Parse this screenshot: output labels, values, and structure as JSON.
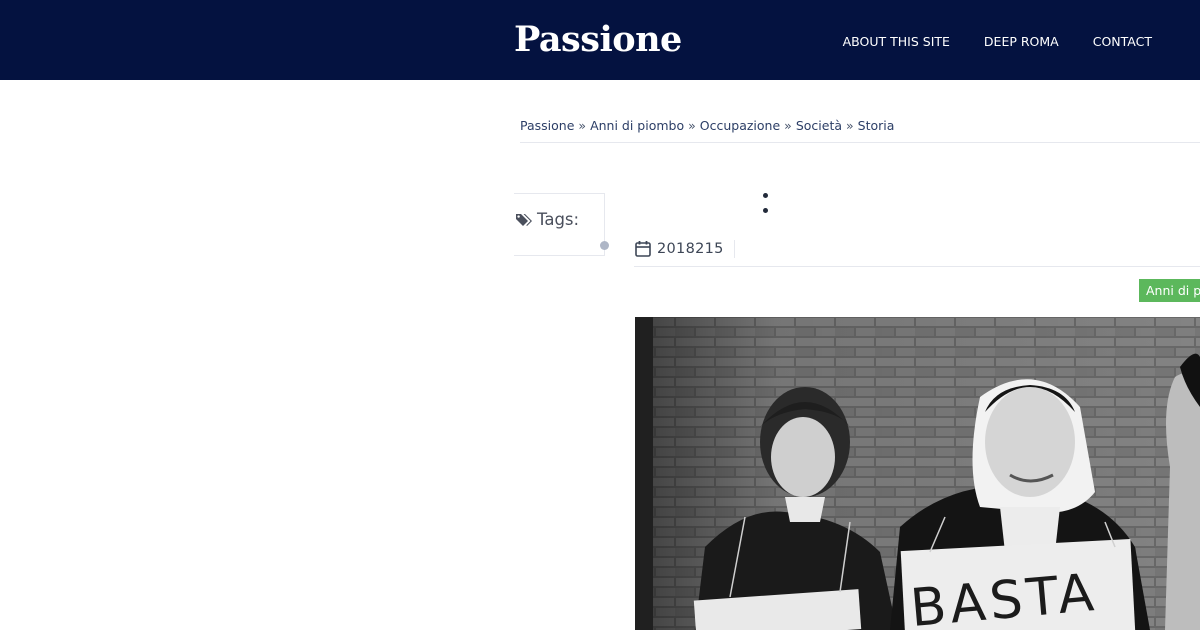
{
  "header": {
    "site_title": "Passione",
    "nav": [
      "ABOUT THIS SITE",
      "DEEP ROMA",
      "CONTACT"
    ],
    "background": "#041240"
  },
  "breadcrumb": {
    "items": [
      "Passione",
      "Anni di piombo",
      "Occupazione",
      "Società",
      "Storia"
    ],
    "separator": "»"
  },
  "tags": {
    "label": "Tags:",
    "icon": "tags-icon"
  },
  "post": {
    "date": "2018215",
    "date_icon": "calendar-icon",
    "category": "Anni di piombo",
    "category_color": "#5cb85c"
  },
  "image": {
    "sign_text": "BASTA"
  }
}
